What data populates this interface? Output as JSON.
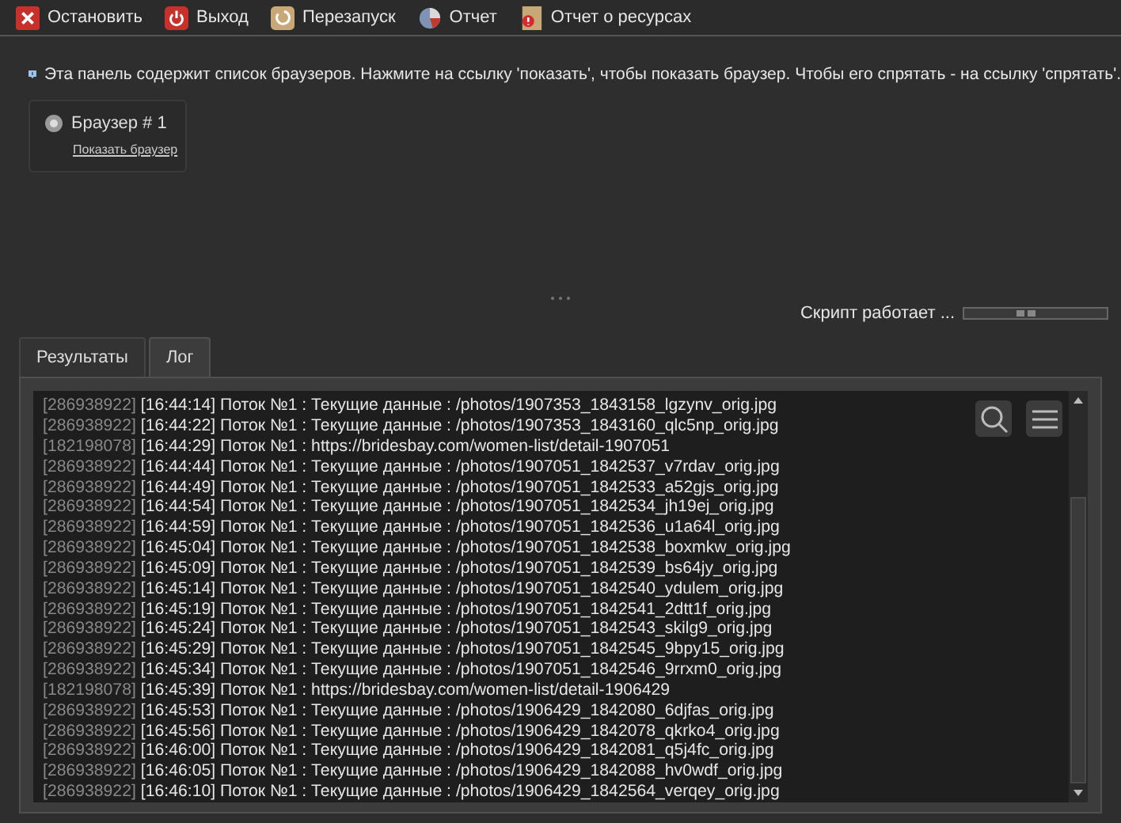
{
  "toolbar": [
    {
      "label": "Остановить",
      "kind": "stop"
    },
    {
      "label": "Выход",
      "kind": "exit"
    },
    {
      "label": "Перезапуск",
      "kind": "restart"
    },
    {
      "label": "Отчет",
      "kind": "report"
    },
    {
      "label": "Отчет о ресурсах",
      "kind": "resources"
    }
  ],
  "info": "Эта панель содержит список браузеров. Нажмите на ссылку 'показать', чтобы показать браузер. Чтобы его спрятать - на ссылку 'спрятать'.",
  "browsers": [
    {
      "title": "Браузер # 1",
      "link": "Показать браузер"
    }
  ],
  "status": "Скрипт работает ...",
  "tabs": [
    {
      "label": "Результаты",
      "selected": false
    },
    {
      "label": "Лог",
      "selected": true
    }
  ],
  "log": [
    {
      "id": "[286938922]",
      "message": "[16:44:14] Поток №1 : Текущие данные : /photos/1907353_1843158_lgzynv_orig.jpg"
    },
    {
      "id": "[286938922]",
      "message": "[16:44:22] Поток №1 : Текущие данные : /photos/1907353_1843160_qlc5np_orig.jpg"
    },
    {
      "id": "[182198078]",
      "message": "[16:44:29] Поток №1 : https://bridesbay.com/women-list/detail-1907051"
    },
    {
      "id": "[286938922]",
      "message": "[16:44:44] Поток №1 : Текущие данные : /photos/1907051_1842537_v7rdav_orig.jpg"
    },
    {
      "id": "[286938922]",
      "message": "[16:44:49] Поток №1 : Текущие данные : /photos/1907051_1842533_a52gjs_orig.jpg"
    },
    {
      "id": "[286938922]",
      "message": "[16:44:54] Поток №1 : Текущие данные : /photos/1907051_1842534_jh19ej_orig.jpg"
    },
    {
      "id": "[286938922]",
      "message": "[16:44:59] Поток №1 : Текущие данные : /photos/1907051_1842536_u1a64l_orig.jpg"
    },
    {
      "id": "[286938922]",
      "message": "[16:45:04] Поток №1 : Текущие данные : /photos/1907051_1842538_boxmkw_orig.jpg"
    },
    {
      "id": "[286938922]",
      "message": "[16:45:09] Поток №1 : Текущие данные : /photos/1907051_1842539_bs64jy_orig.jpg"
    },
    {
      "id": "[286938922]",
      "message": "[16:45:14] Поток №1 : Текущие данные : /photos/1907051_1842540_ydulem_orig.jpg"
    },
    {
      "id": "[286938922]",
      "message": "[16:45:19] Поток №1 : Текущие данные : /photos/1907051_1842541_2dtt1f_orig.jpg"
    },
    {
      "id": "[286938922]",
      "message": "[16:45:24] Поток №1 : Текущие данные : /photos/1907051_1842543_skilg9_orig.jpg"
    },
    {
      "id": "[286938922]",
      "message": "[16:45:29] Поток №1 : Текущие данные : /photos/1907051_1842545_9bpy15_orig.jpg"
    },
    {
      "id": "[286938922]",
      "message": "[16:45:34] Поток №1 : Текущие данные : /photos/1907051_1842546_9rrxm0_orig.jpg"
    },
    {
      "id": "[182198078]",
      "message": "[16:45:39] Поток №1 : https://bridesbay.com/women-list/detail-1906429"
    },
    {
      "id": "[286938922]",
      "message": "[16:45:53] Поток №1 : Текущие данные : /photos/1906429_1842080_6djfas_orig.jpg"
    },
    {
      "id": "[286938922]",
      "message": "[16:45:56] Поток №1 : Текущие данные : /photos/1906429_1842078_qkrko4_orig.jpg"
    },
    {
      "id": "[286938922]",
      "message": "[16:46:00] Поток №1 : Текущие данные : /photos/1906429_1842081_q5j4fc_orig.jpg"
    },
    {
      "id": "[286938922]",
      "message": "[16:46:05] Поток №1 : Текущие данные : /photos/1906429_1842088_hv0wdf_orig.jpg"
    },
    {
      "id": "[286938922]",
      "message": "[16:46:10] Поток №1 : Текущие данные : /photos/1906429_1842564_verqey_orig.jpg"
    }
  ]
}
